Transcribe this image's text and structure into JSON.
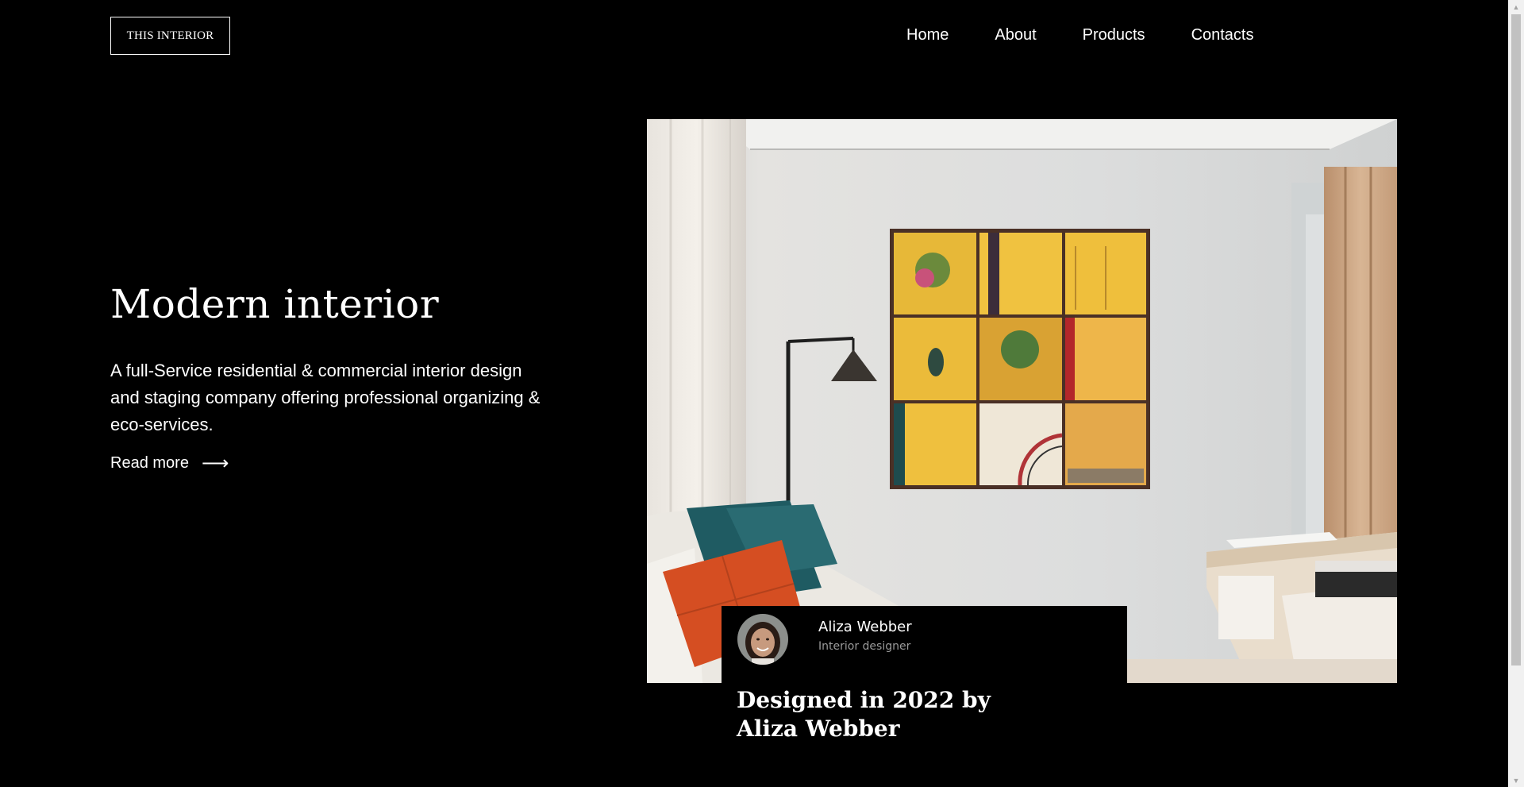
{
  "header": {
    "logo": "THIS INTERIOR",
    "nav": [
      "Home",
      "About",
      "Products",
      "Contacts"
    ]
  },
  "hero": {
    "title": "Modern interior",
    "description": "A full-Service residential & commercial interior design and staging company offering professional organizing & eco-services.",
    "read_more": "Read more",
    "read_more_icon": "arrow-right-icon"
  },
  "designer": {
    "name": "Aliza Webber",
    "role": "Interior designer",
    "caption": "Designed in 2022 by Aliza Webber"
  },
  "colors": {
    "background": "#000000",
    "text": "#ffffff",
    "muted": "#9a9a9a",
    "scrollbar_track": "#f1f1f1",
    "scrollbar_thumb": "#c1c1c1"
  }
}
